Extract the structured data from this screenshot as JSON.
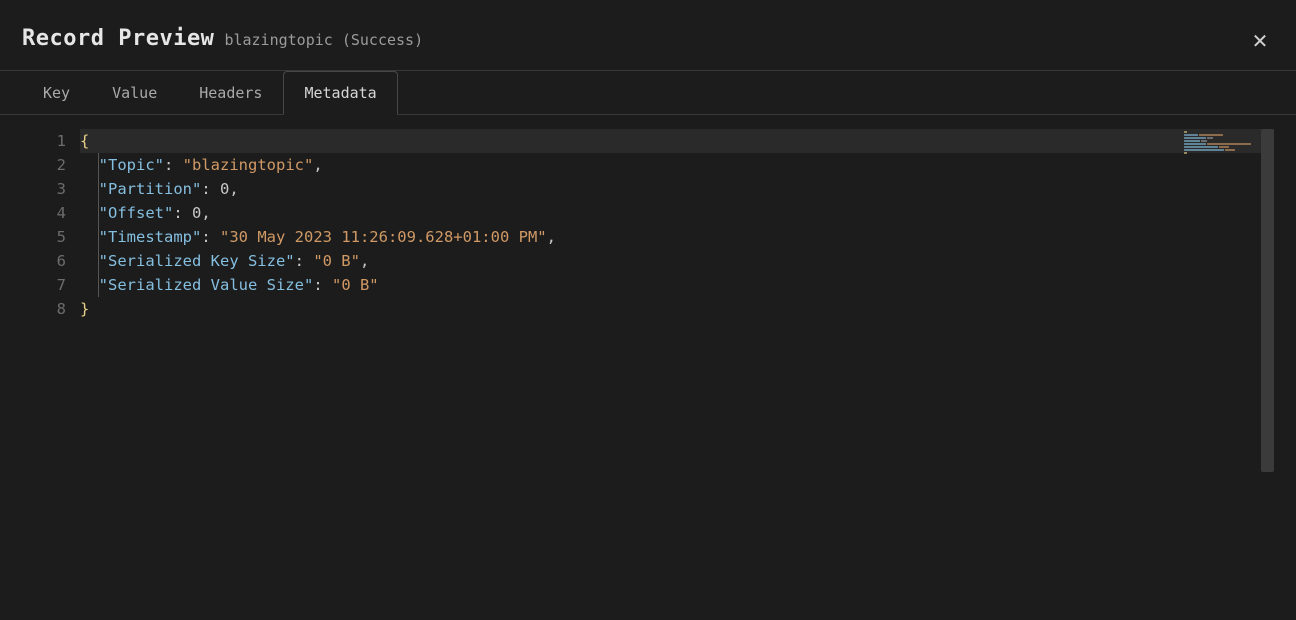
{
  "header": {
    "title": "Record Preview",
    "topic_name": "blazingtopic",
    "status": "Success"
  },
  "tabs": [
    {
      "id": "key",
      "label": "Key",
      "active": false
    },
    {
      "id": "value",
      "label": "Value",
      "active": false
    },
    {
      "id": "headers",
      "label": "Headers",
      "active": false
    },
    {
      "id": "metadata",
      "label": "Metadata",
      "active": true
    }
  ],
  "editor": {
    "line_numbers": [
      1,
      2,
      3,
      4,
      5,
      6,
      7,
      8
    ],
    "active_line": 1
  },
  "metadata": {
    "Topic": "blazingtopic",
    "Partition": 0,
    "Offset": 0,
    "Timestamp": "30 May 2023 11:26:09.628+01:00 PM",
    "Serialized Key Size": "0 B",
    "Serialized Value Size": "0 B"
  },
  "json_lines": [
    {
      "type": "open"
    },
    {
      "type": "kv",
      "key": "Topic",
      "valType": "string",
      "value": "blazingtopic",
      "comma": true
    },
    {
      "type": "kv",
      "key": "Partition",
      "valType": "number",
      "value": "0",
      "comma": true
    },
    {
      "type": "kv",
      "key": "Offset",
      "valType": "number",
      "value": "0",
      "comma": true
    },
    {
      "type": "kv",
      "key": "Timestamp",
      "valType": "string",
      "value": "30 May 2023 11:26:09.628+01:00 PM",
      "comma": true
    },
    {
      "type": "kv",
      "key": "Serialized Key Size",
      "valType": "string",
      "value": "0 B",
      "comma": true
    },
    {
      "type": "kv",
      "key": "Serialized Value Size",
      "valType": "string",
      "value": "0 B",
      "comma": false
    },
    {
      "type": "close"
    }
  ]
}
